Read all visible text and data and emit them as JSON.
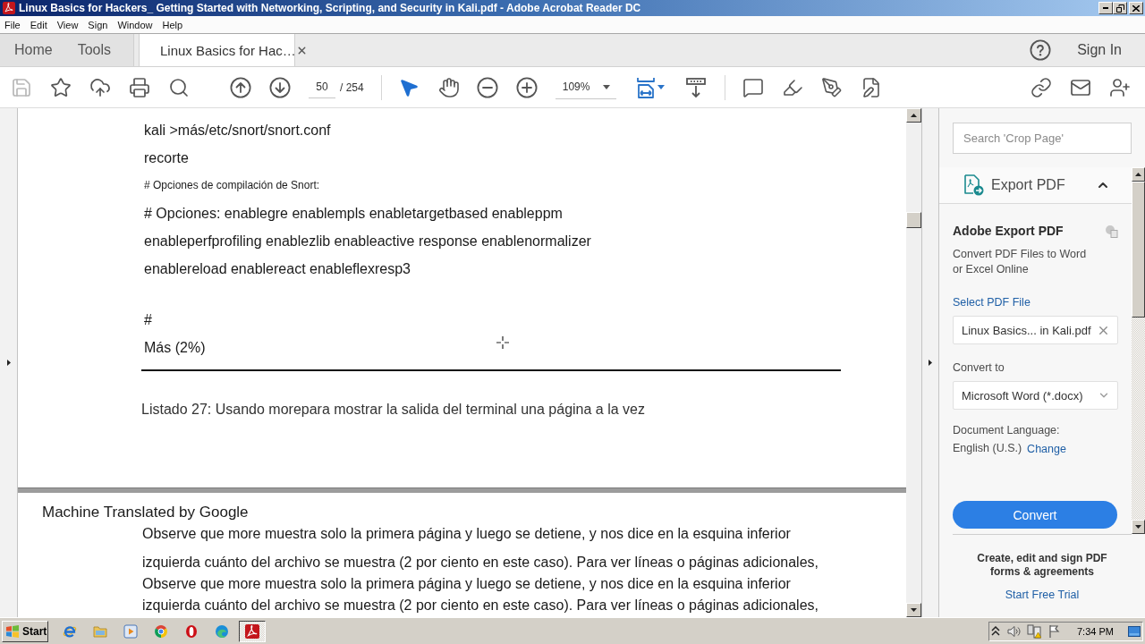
{
  "window": {
    "title": "Linux Basics for Hackers_ Getting Started with Networking, Scripting, and Security in Kali.pdf - Adobe Acrobat Reader DC"
  },
  "menu_bar": [
    "File",
    "Edit",
    "View",
    "Sign",
    "Window",
    "Help"
  ],
  "tabs": [
    {
      "label": "Home",
      "kind": "nav",
      "selected": false
    },
    {
      "label": "Tools",
      "kind": "nav",
      "selected": false
    },
    {
      "label": "Linux Basics for Hac…",
      "kind": "document",
      "selected": true
    }
  ],
  "account": {
    "sign_in": "Sign In"
  },
  "toolbar": {
    "file_buttons": [
      {
        "kind": "save",
        "disabled": true
      },
      {
        "kind": "bookmark",
        "disabled": false
      },
      {
        "kind": "upload",
        "disabled": false
      },
      {
        "kind": "print",
        "disabled": false
      },
      {
        "kind": "find",
        "disabled": false
      }
    ],
    "page_nav": [
      {
        "kind": "previous"
      },
      {
        "kind": "next"
      }
    ],
    "page_number": "50",
    "page_total": "/ 254",
    "tools": [
      {
        "kind": "select",
        "selected": true
      },
      {
        "kind": "hand",
        "selected": false
      }
    ],
    "zoom_buttons": [
      {
        "kind": "out"
      },
      {
        "kind": "in"
      }
    ],
    "zoom_level": "109%",
    "view_buttons": [
      {
        "kind": "fit"
      },
      {
        "kind": "scroll"
      }
    ],
    "annotate_buttons": [
      {
        "kind": "comment"
      },
      {
        "kind": "highlight"
      },
      {
        "kind": "sign"
      },
      {
        "kind": "edit"
      }
    ],
    "share_buttons": [
      {
        "kind": "link"
      },
      {
        "kind": "mail"
      },
      {
        "kind": "adduser"
      }
    ]
  },
  "document": {
    "pages": [
      {
        "kind": "listing",
        "blocks": [
          [
            {
              "kind": "normal",
              "text": "kali >más/etc/snort/snort.conf"
            },
            {
              "kind": "normal",
              "text": "recorte"
            },
            {
              "kind": "small",
              "text": "# Opciones de compilación de Snort:"
            },
            {
              "kind": "normal",
              "text": "# Opciones: enablegre enablempls enabletargetbased enableppm"
            },
            {
              "kind": "normal",
              "text": "enableperfprofiling enablezlib enableactive response enablenormalizer"
            },
            {
              "kind": "normal",
              "text": "enablereload enablereact enableflexresp3"
            }
          ],
          [
            {
              "kind": "normal",
              "text": "#"
            },
            {
              "kind": "normal",
              "text": "Más (2%)"
            }
          ]
        ],
        "caption": "Listado 27: Usando morepara mostrar la salida del terminal una página a la vez"
      },
      {
        "kind": "translated",
        "header": "Machine Translated by Google",
        "lines": [
          "Observe que more muestra solo la primera página y luego se detiene, y nos dice en la esquina inferior",
          "izquierda cuánto del archivo se muestra (2 por ciento en este caso). Para ver líneas o páginas adicionales,",
          "Observe que more muestra solo la primera página y luego se detiene, y nos dice en la esquina inferior",
          "izquierda cuánto del archivo se muestra (2 por ciento en este caso). Para ver líneas o páginas adicionales,"
        ]
      }
    ]
  },
  "right_panel": {
    "search": {
      "placeholder": "Search 'Crop Page'"
    },
    "tool": {
      "title": "Export PDF",
      "expanded": true,
      "heading": "Adobe Export PDF",
      "description": "Convert PDF Files to Word or Excel Online",
      "select_label": "Select PDF File",
      "file": "Linux Basics... in Kali.pdf",
      "convert_label": "Convert to",
      "format": "Microsoft Word (*.docx)",
      "language_label": "Document Language:",
      "language": "English (U.S.)",
      "change_link": "Change",
      "button": "Convert"
    },
    "promo": {
      "text": "Create, edit and sign PDF forms & agreements",
      "link": "Start Free Trial"
    }
  },
  "taskbar": {
    "start": "Start",
    "apps": [
      {
        "kind": "ie",
        "selected": false
      },
      {
        "kind": "folder",
        "selected": false
      },
      {
        "kind": "media",
        "selected": false
      },
      {
        "kind": "chrome",
        "selected": false
      },
      {
        "kind": "opera",
        "selected": false
      },
      {
        "kind": "edge",
        "selected": false
      },
      {
        "kind": "acrobat",
        "selected": true
      }
    ],
    "tray": [
      {
        "kind": "expand"
      },
      {
        "kind": "speaker"
      },
      {
        "kind": "network"
      },
      {
        "kind": "flag"
      }
    ],
    "clock": "7:34 PM"
  }
}
